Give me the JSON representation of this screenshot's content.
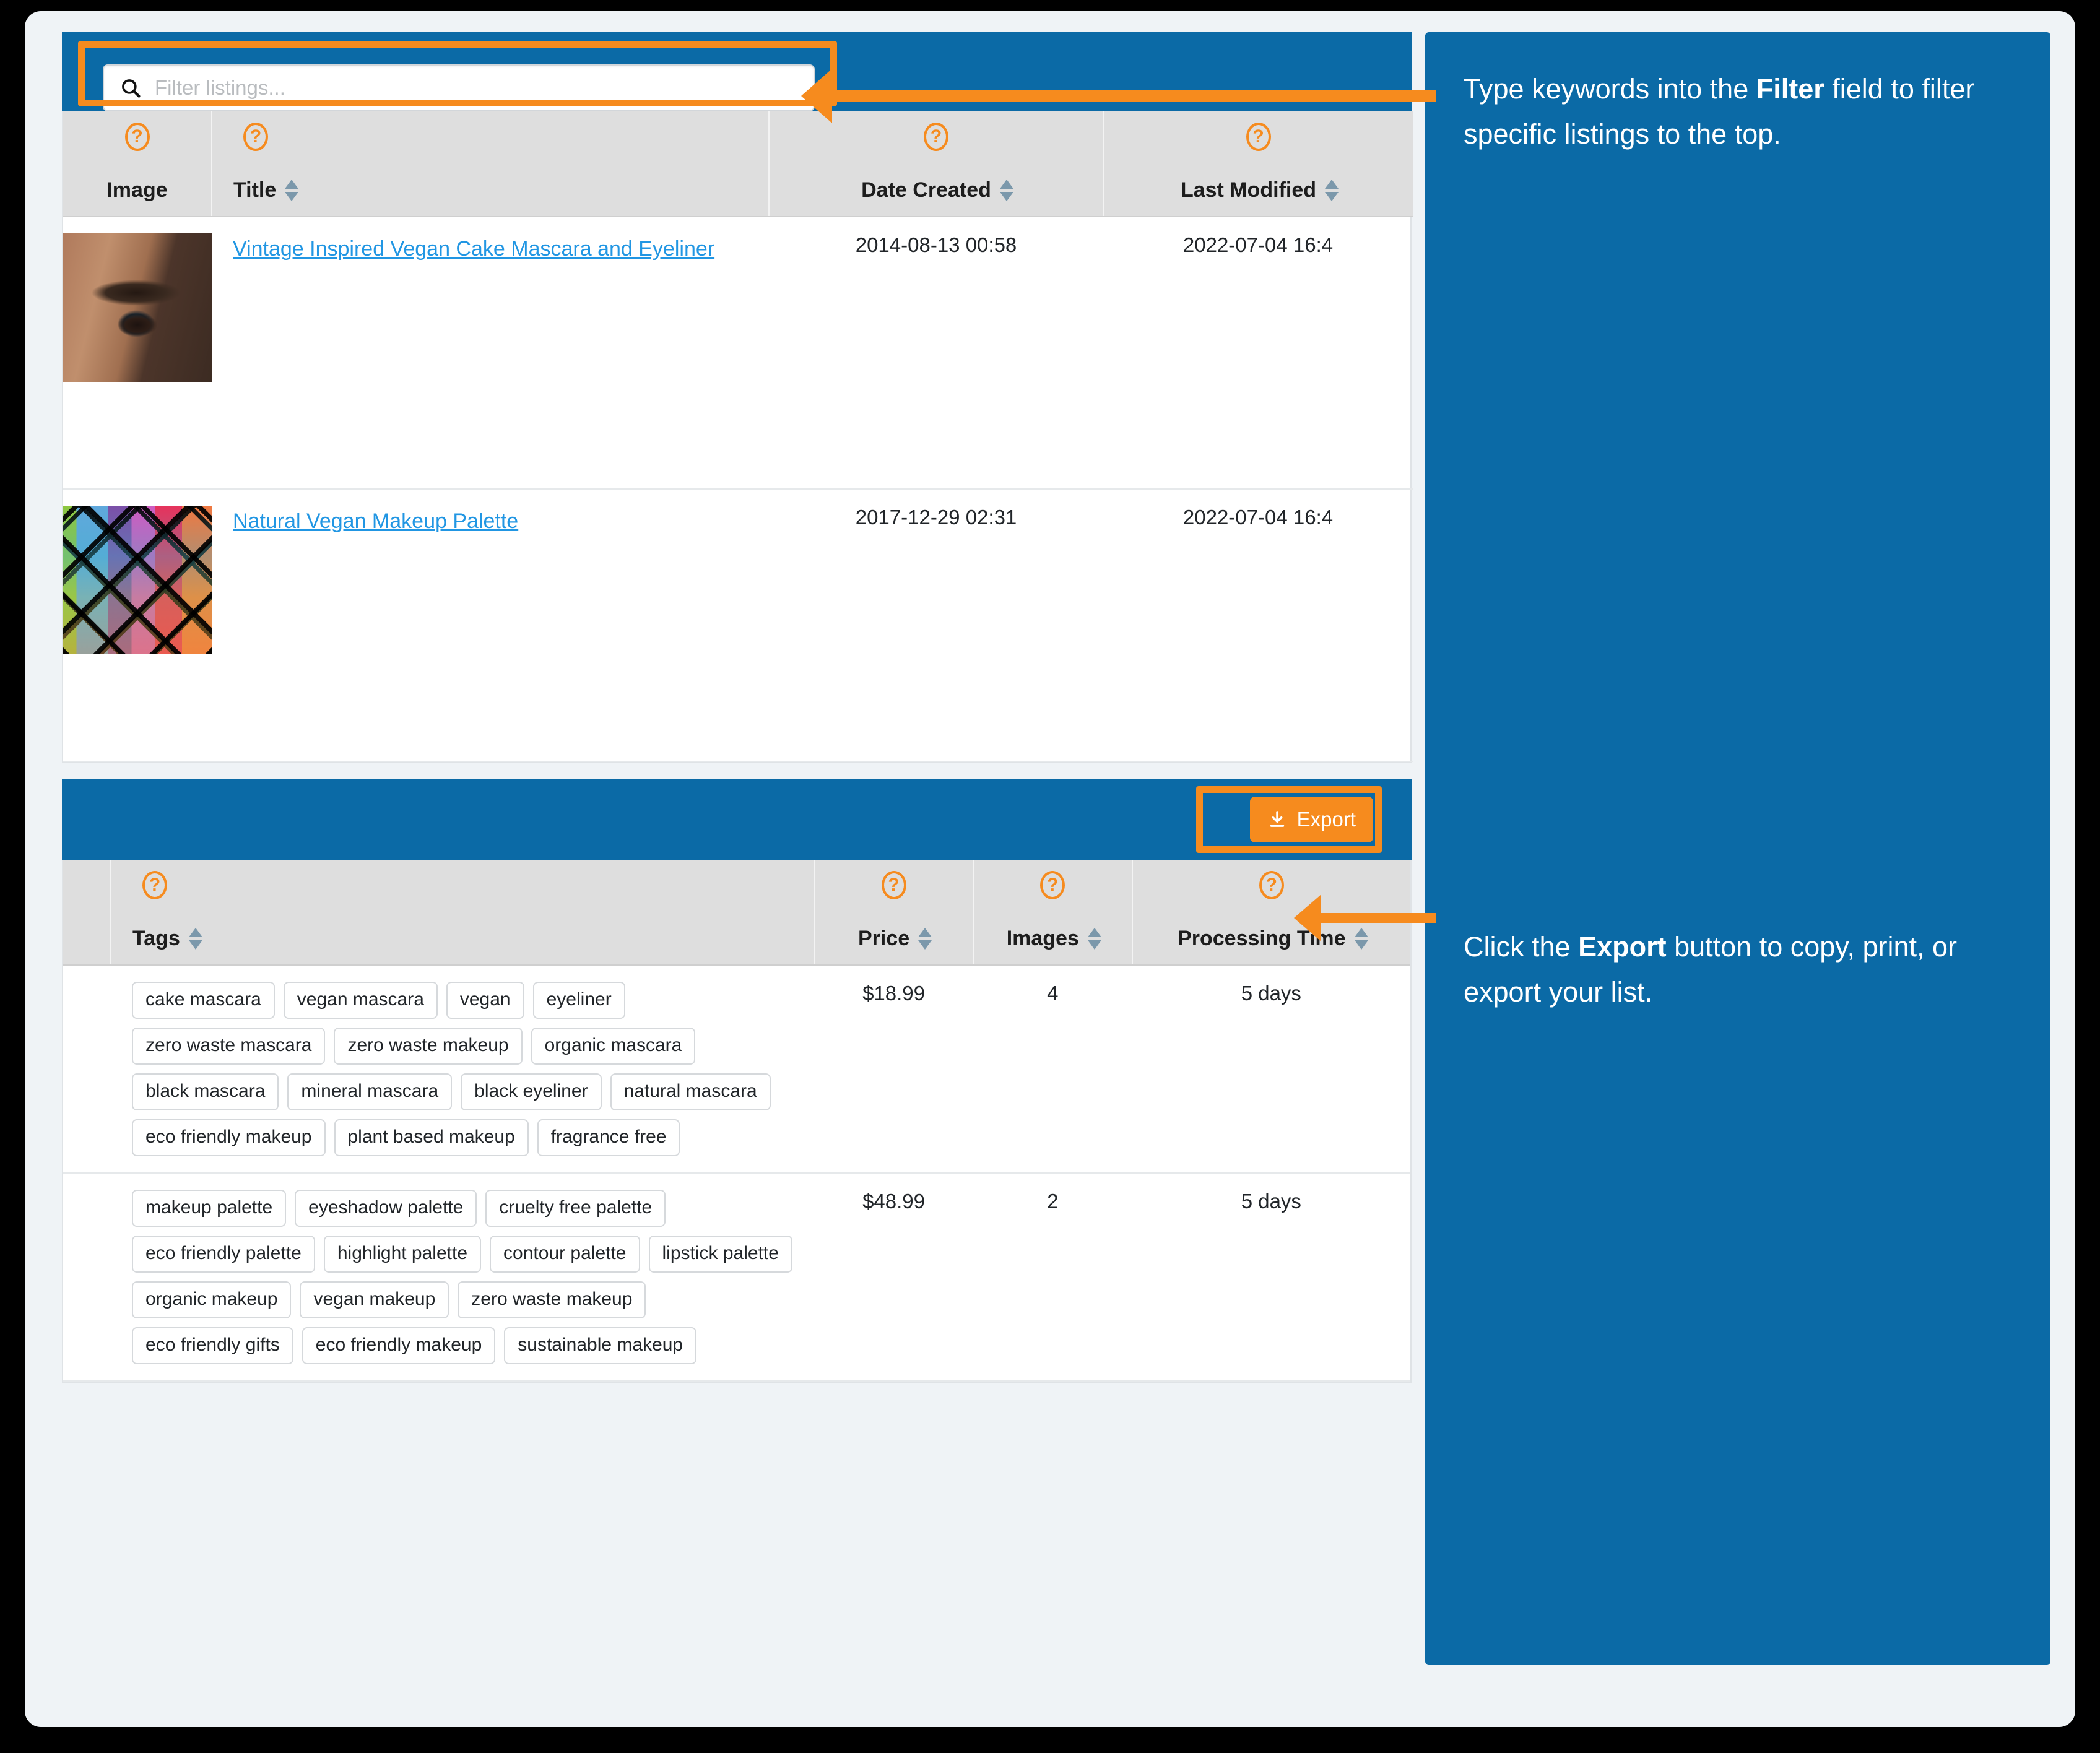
{
  "search": {
    "placeholder": "Filter listings...",
    "value": "",
    "icon": "search-icon"
  },
  "listings_table": {
    "columns": [
      {
        "label": "Image",
        "sortable": false,
        "help": "?"
      },
      {
        "label": "Title",
        "sortable": true,
        "help": "?"
      },
      {
        "label": "Date Created",
        "sortable": true,
        "help": "?"
      },
      {
        "label": "Last Modified",
        "sortable": true,
        "help": "?"
      }
    ],
    "rows": [
      {
        "image_alt": "close-up of eye with mascara",
        "title": "Vintage Inspired Vegan Cake Mascara and Eyeliner",
        "date_created": "2014-08-13 00:58",
        "last_modified": "2022-07-04 16:4"
      },
      {
        "image_alt": "colorful eyeshadow makeup palette",
        "title": "Natural Vegan Makeup Palette",
        "date_created": "2017-12-29 02:31",
        "last_modified": "2022-07-04 16:4"
      }
    ]
  },
  "export": {
    "label": "Export",
    "icon": "download-icon"
  },
  "details_table": {
    "columns": [
      {
        "label": "",
        "sortable": false,
        "help": ""
      },
      {
        "label": "Tags",
        "sortable": true,
        "help": "?"
      },
      {
        "label": "Price",
        "sortable": true,
        "help": "?"
      },
      {
        "label": "Images",
        "sortable": true,
        "help": "?"
      },
      {
        "label": "Processing Time",
        "sortable": true,
        "help": "?"
      }
    ],
    "rows": [
      {
        "tags": [
          "cake mascara",
          "vegan mascara",
          "vegan",
          "eyeliner",
          "zero waste mascara",
          "zero waste makeup",
          "organic mascara",
          "black mascara",
          "mineral mascara",
          "black eyeliner",
          "natural mascara",
          "eco friendly makeup",
          "plant based makeup",
          "fragrance free"
        ],
        "price": "$18.99",
        "images": "4",
        "processing_time": "5 days"
      },
      {
        "tags": [
          "makeup palette",
          "eyeshadow palette",
          "cruelty free palette",
          "eco friendly palette",
          "highlight palette",
          "contour palette",
          "lipstick palette",
          "organic makeup",
          "vegan makeup",
          "zero waste makeup",
          "eco friendly gifts",
          "eco friendly makeup",
          "sustainable makeup"
        ],
        "price": "$48.99",
        "images": "2",
        "processing_time": "5 days"
      }
    ]
  },
  "callouts": {
    "filter": {
      "part1": "Type keywords into the ",
      "bold": "Filter",
      "part2": " field to filter specific listings to the top."
    },
    "export": {
      "part1": "Click the ",
      "bold": "Export",
      "part2": " button to copy, print, or export your list."
    }
  },
  "colors": {
    "accent_blue": "#0b6aa6",
    "accent_orange": "#f68b1e",
    "link_blue": "#2196e3",
    "header_gray": "#dedede",
    "sort_arrow": "#7b98ab"
  }
}
